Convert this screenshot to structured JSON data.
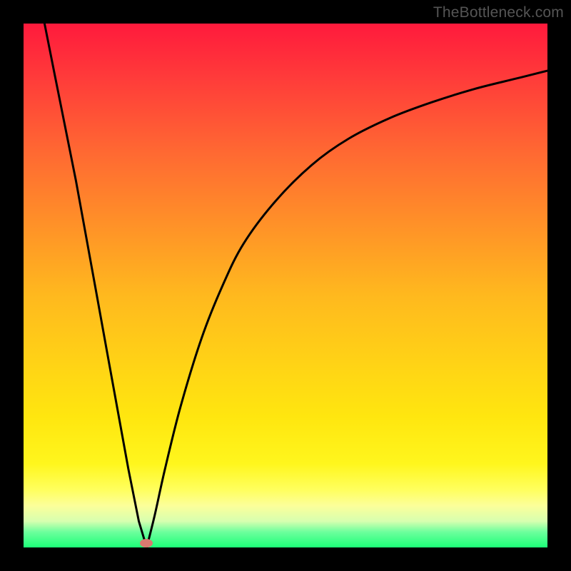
{
  "watermark": "TheBottleneck.com",
  "chart_data": {
    "type": "line",
    "title": "",
    "xlabel": "",
    "ylabel": "",
    "xlim": [
      0,
      100
    ],
    "ylim": [
      0,
      100
    ],
    "grid": false,
    "legend": false,
    "background_gradient": {
      "top_color": "#ff1a3c",
      "mid_color": "#ffd515",
      "bottom_color": "#1cff78"
    },
    "series": [
      {
        "name": "left-branch",
        "x": [
          4,
          6,
          8,
          10,
          12,
          14,
          16,
          18,
          20,
          22,
          23.5
        ],
        "y": [
          100,
          90,
          80,
          70,
          59,
          48,
          37,
          26,
          15,
          5,
          0
        ],
        "stroke": "#000000"
      },
      {
        "name": "right-branch",
        "x": [
          23.5,
          25,
          27,
          30,
          34,
          38,
          42,
          48,
          55,
          62,
          70,
          78,
          86,
          94,
          100
        ],
        "y": [
          0,
          6,
          15,
          27,
          40,
          50,
          58,
          66,
          73,
          78,
          82,
          85,
          87.5,
          89.5,
          91
        ],
        "stroke": "#000000"
      }
    ],
    "marker": {
      "name": "bottleneck-point",
      "x": 23.5,
      "y": 0.5,
      "color": "#d97a70",
      "shape": "ellipse"
    }
  }
}
